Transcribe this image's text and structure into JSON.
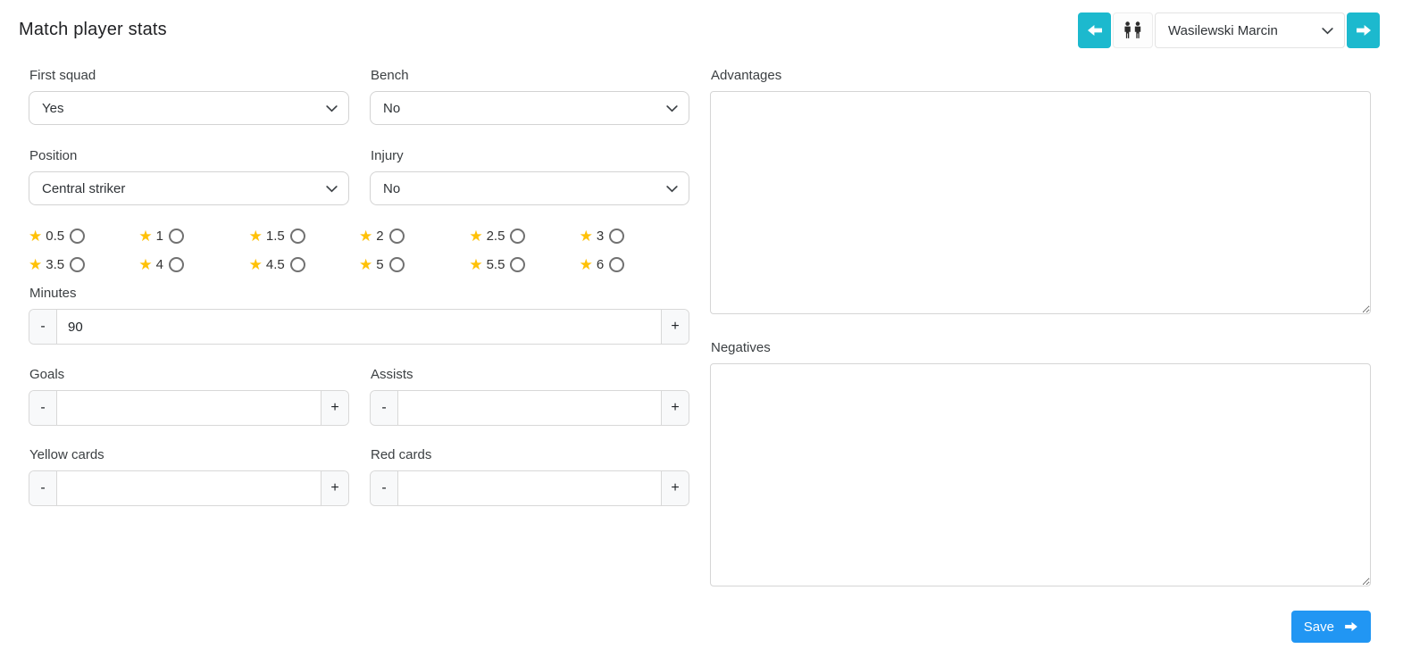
{
  "title": "Match player stats",
  "colors": {
    "accent_cyan": "#1cb9ce",
    "save_blue": "#2196f3",
    "star_gold": "#ffc107"
  },
  "player_nav": {
    "prev_icon": "arrow-left",
    "players_icon": "two-persons",
    "player_select_value": "Wasilewski Marcin",
    "next_icon": "arrow-right"
  },
  "fields": {
    "first_squad": {
      "label": "First squad",
      "value": "Yes"
    },
    "bench": {
      "label": "Bench",
      "value": "No"
    },
    "position": {
      "label": "Position",
      "value": "Central striker"
    },
    "injury": {
      "label": "Injury",
      "value": "No"
    },
    "minutes": {
      "label": "Minutes",
      "value": "90"
    },
    "goals": {
      "label": "Goals",
      "value": ""
    },
    "assists": {
      "label": "Assists",
      "value": ""
    },
    "yellow_cards": {
      "label": "Yellow cards",
      "value": ""
    },
    "red_cards": {
      "label": "Red cards",
      "value": ""
    },
    "advantages": {
      "label": "Advantages",
      "value": ""
    },
    "negatives": {
      "label": "Negatives",
      "value": ""
    }
  },
  "stepper": {
    "minus": "-",
    "plus": "+"
  },
  "rating": {
    "selected": null,
    "options": [
      "0.5",
      "1",
      "1.5",
      "2",
      "2.5",
      "3",
      "3.5",
      "4",
      "4.5",
      "5",
      "5.5",
      "6"
    ]
  },
  "save": {
    "label": "Save"
  }
}
